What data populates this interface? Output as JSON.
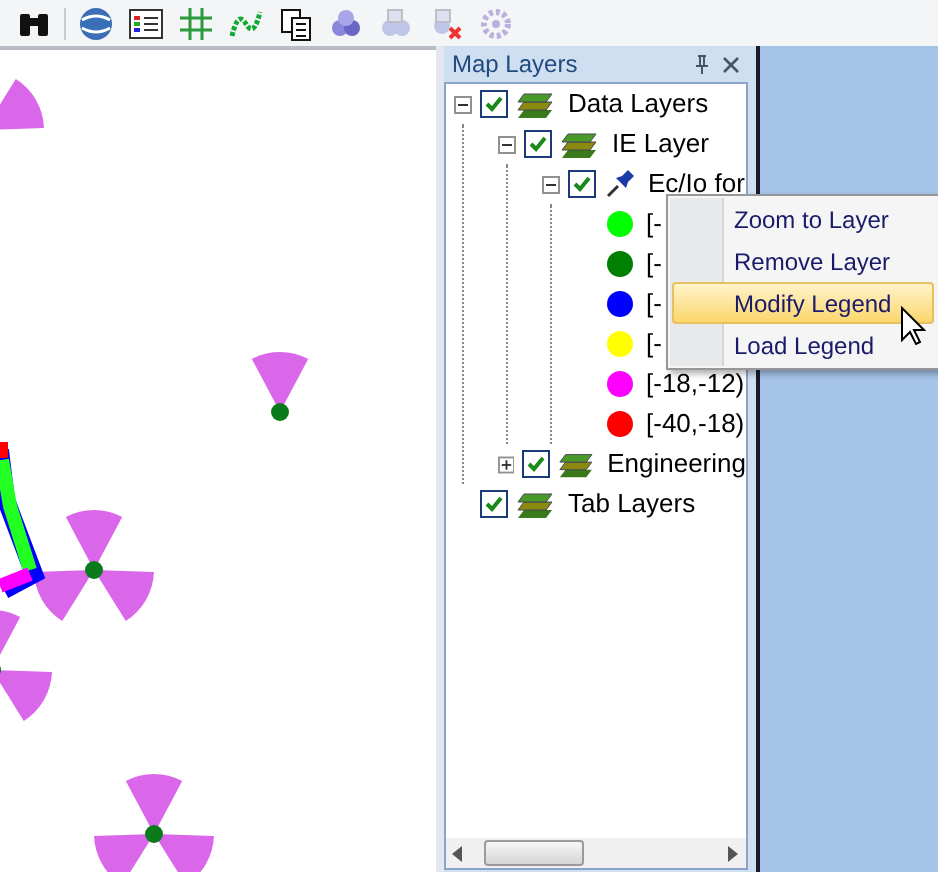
{
  "panel": {
    "title": "Map Layers"
  },
  "tree": [
    {
      "kind": "group",
      "label": "Data Layers",
      "checked": true,
      "expanded": true,
      "children": [
        {
          "kind": "group",
          "label": "IE Layer",
          "checked": true,
          "expanded": true,
          "children": [
            {
              "kind": "layer",
              "label": "Ec/Io for",
              "checked": true,
              "expanded": true,
              "children": [
                {
                  "kind": "legend",
                  "label": "[-",
                  "color": "#00ff00"
                },
                {
                  "kind": "legend",
                  "label": "[-",
                  "color": "#008000"
                },
                {
                  "kind": "legend",
                  "label": "[-",
                  "color": "#0000ff"
                },
                {
                  "kind": "legend",
                  "label": "[-",
                  "color": "#ffff00"
                },
                {
                  "kind": "legend",
                  "label": "[-18,-12)",
                  "color": "#ff00ff"
                },
                {
                  "kind": "legend",
                  "label": "[-40,-18)",
                  "color": "#ff0000"
                }
              ]
            }
          ]
        },
        {
          "kind": "group",
          "label": "Engineering",
          "checked": true,
          "expanded": false
        }
      ]
    },
    {
      "kind": "group",
      "label": "Tab Layers",
      "checked": true
    }
  ],
  "context_menu": {
    "items": [
      {
        "label": "Zoom to Layer",
        "selected": false
      },
      {
        "label": "Remove Layer",
        "selected": false
      },
      {
        "label": "Modify Legend",
        "selected": true
      },
      {
        "label": "Load Legend",
        "selected": false
      }
    ]
  }
}
